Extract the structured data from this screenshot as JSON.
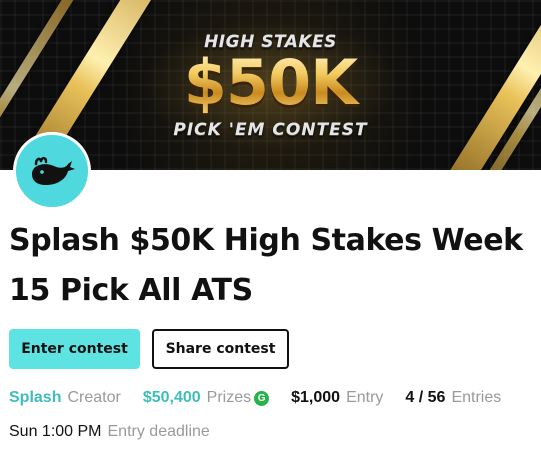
{
  "banner": {
    "line1": "HIGH STAKES",
    "amount": "$50K",
    "line2": "PICK 'EM CONTEST",
    "colors": {
      "gold": "#f0c14b",
      "background": "#0d0d0d"
    }
  },
  "creator_avatar": {
    "icon": "whale-icon",
    "color": "#4fd8dd"
  },
  "contest": {
    "title": "Splash $50K High Stakes Week 15 Pick All ATS"
  },
  "actions": {
    "enter_label": "Enter contest",
    "share_label": "Share contest",
    "accent": "#5ee3e3"
  },
  "stats": {
    "creator": {
      "value": "Splash",
      "label": "Creator"
    },
    "prizes": {
      "value": "$50,400",
      "label": "Prizes",
      "badge": "G"
    },
    "entry": {
      "value": "$1,000",
      "label": "Entry"
    },
    "entries": {
      "value": "4 / 56",
      "label": "Entries"
    }
  },
  "deadline": {
    "value": "Sun 1:00 PM",
    "label": "Entry deadline"
  }
}
